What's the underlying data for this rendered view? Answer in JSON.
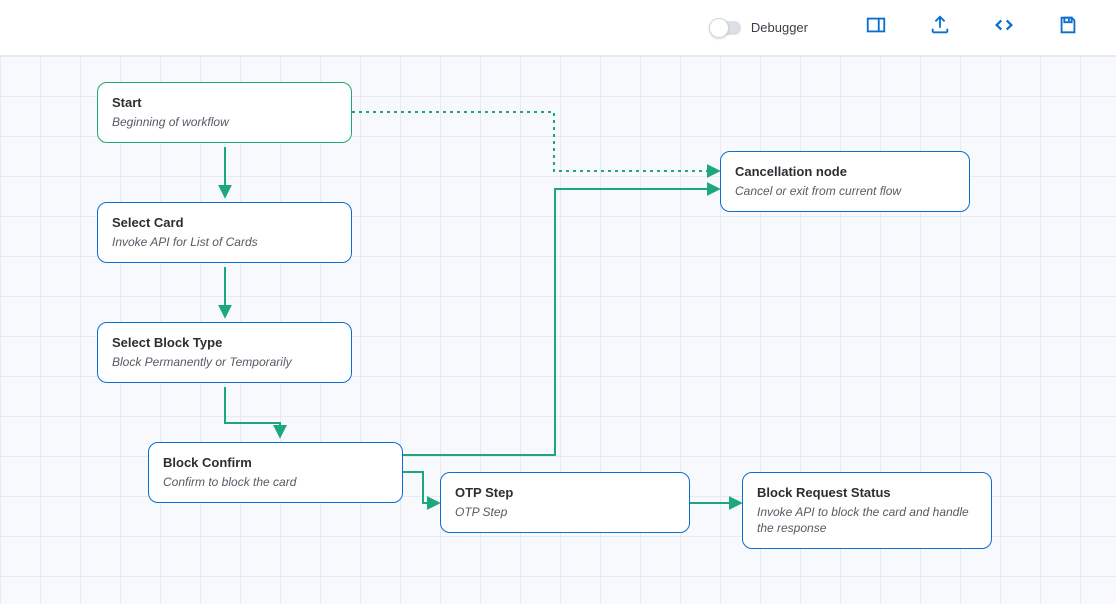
{
  "toolbar": {
    "debugger_label": "Debugger"
  },
  "nodes": {
    "start": {
      "title": "Start",
      "sub": "Beginning of workflow"
    },
    "selectCard": {
      "title": "Select Card",
      "sub": "Invoke API for List of Cards"
    },
    "blockType": {
      "title": "Select Block Type",
      "sub": "Block Permanently or Temporarily"
    },
    "blockConfirm": {
      "title": "Block Confirm",
      "sub": "Confirm to block the card"
    },
    "otp": {
      "title": "OTP Step",
      "sub": "OTP Step"
    },
    "cancel": {
      "title": "Cancellation node",
      "sub": "Cancel or exit from current flow"
    },
    "status": {
      "title": "Block Request Status",
      "sub": "Invoke API to block the card and handle the response"
    }
  },
  "colors": {
    "wire": "#1da77d",
    "icon": "#0a6ed1"
  }
}
